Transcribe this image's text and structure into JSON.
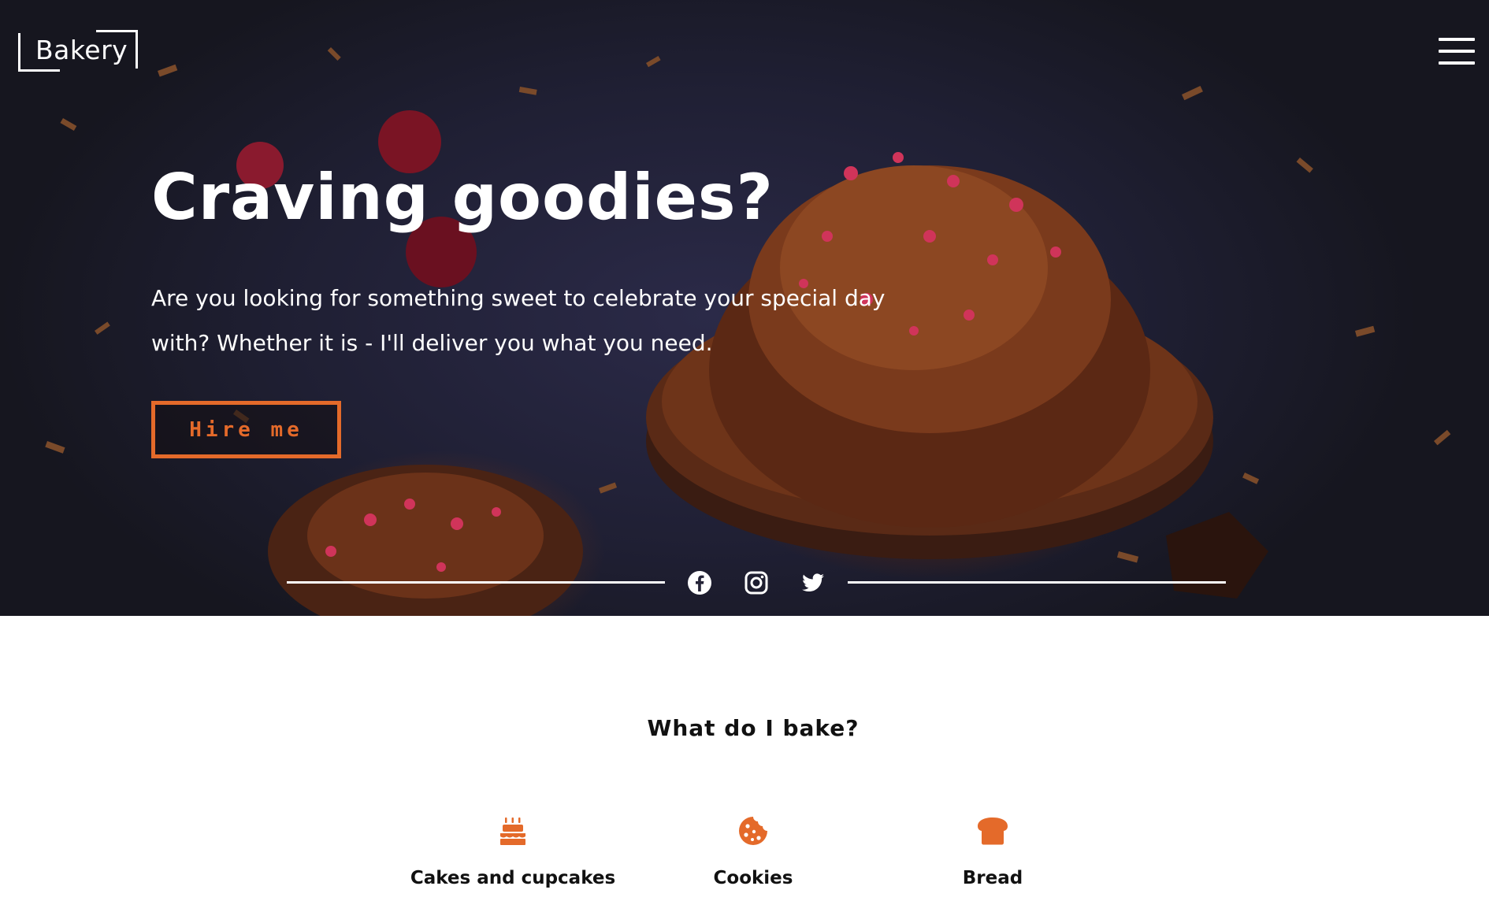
{
  "brand": {
    "logo_text": "Bakery"
  },
  "nav": {
    "menu_icon": "hamburger-menu-icon"
  },
  "hero": {
    "title": "Craving goodies?",
    "text": "Are you looking for something sweet to celebrate your special day with? Whether it is - I'll deliver you what you need.",
    "cta_label": "Hire me"
  },
  "social": {
    "icons": [
      "facebook-icon",
      "instagram-icon",
      "twitter-icon"
    ]
  },
  "section": {
    "title": "What do I bake?",
    "items": [
      {
        "label": "Cakes and cupcakes",
        "icon": "birthday-cake-icon"
      },
      {
        "label": "Cookies",
        "icon": "cookie-icon"
      },
      {
        "label": "Bread",
        "icon": "bread-icon"
      }
    ]
  },
  "colors": {
    "accent": "#e46a2a",
    "hero_bg": "#1f1f33",
    "text_light": "#ffffff",
    "text_dark": "#111111"
  }
}
